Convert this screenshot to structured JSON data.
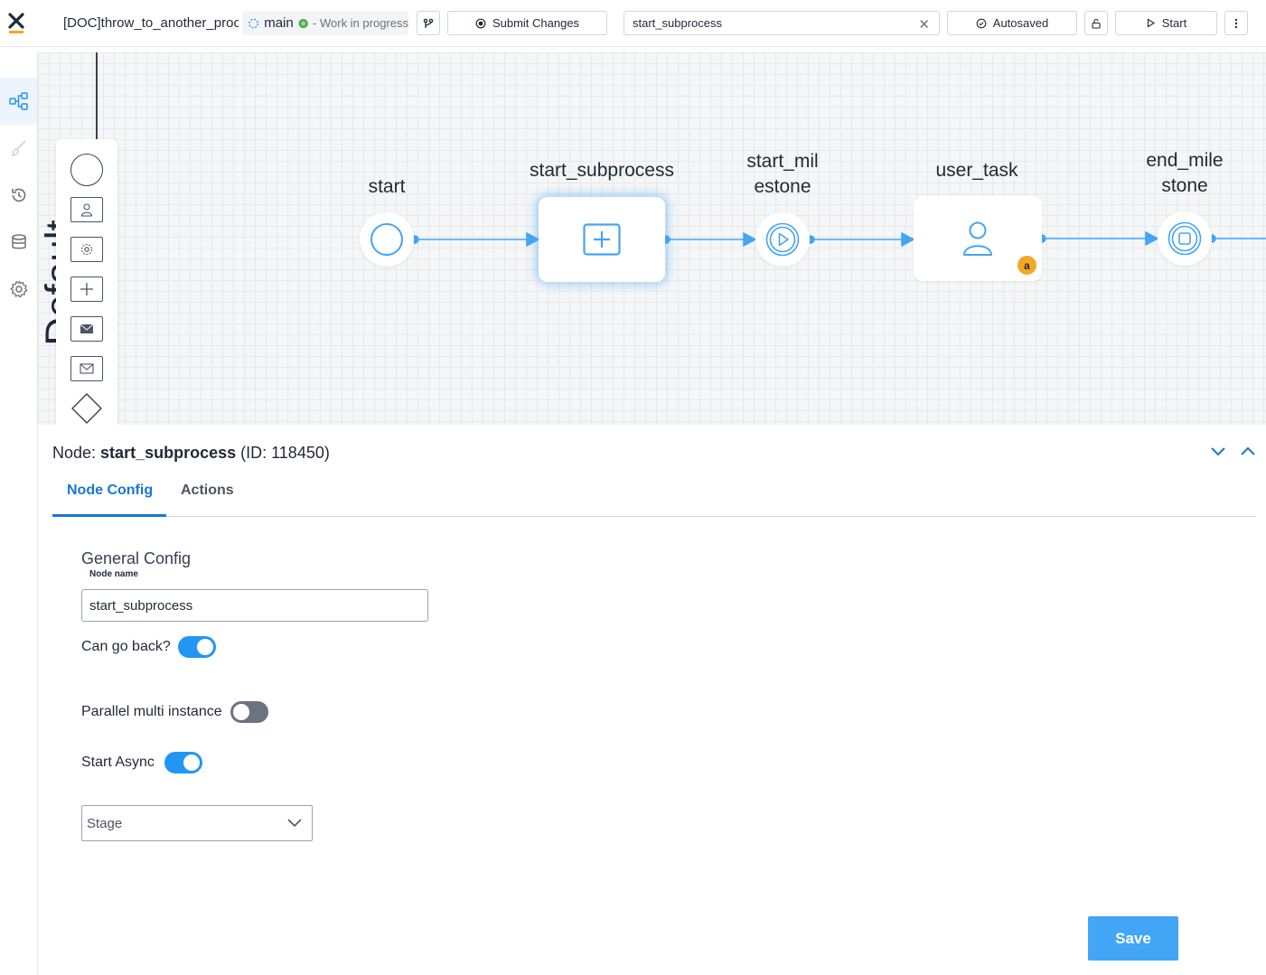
{
  "header": {
    "title": "[DOC]throw_to_another_proc",
    "branch": "main",
    "branch_status": "- Work in progress",
    "submit_label": "Submit Changes",
    "search_value": "start_subprocess",
    "autosaved_label": "Autosaved",
    "start_label": "Start"
  },
  "sidebar": {
    "items": [
      "process-diagram-icon",
      "brush-icon",
      "history-icon",
      "database-icon",
      "settings-icon"
    ]
  },
  "canvas": {
    "swimlane_label": "Default",
    "nodes": {
      "start": "start",
      "start_subprocess": "start_subprocess",
      "start_milestone_line1": "start_mil",
      "start_milestone_line2": "estone",
      "user_task": "user_task",
      "user_task_badge": "a",
      "end_milestone_line1": "end_mile",
      "end_milestone_line2": "stone"
    }
  },
  "panel": {
    "title_prefix": "Node: ",
    "node_name": "start_subprocess",
    "node_id": " (ID: 118450)",
    "tabs": [
      "Node Config",
      "Actions"
    ],
    "section_title": "General Config",
    "node_name_label": "Node name",
    "node_name_value": "start_subprocess",
    "can_go_back_label": "Can go back?",
    "can_go_back": true,
    "parallel_label": "Parallel multi instance",
    "parallel": false,
    "start_async_label": "Start Async",
    "start_async": true,
    "stage_placeholder": "Stage",
    "save_label": "Save"
  },
  "colors": {
    "accent": "#2196f3",
    "primary_blue": "#1976d2",
    "save_button": "#42a5f5",
    "badge": "#f5a623"
  }
}
